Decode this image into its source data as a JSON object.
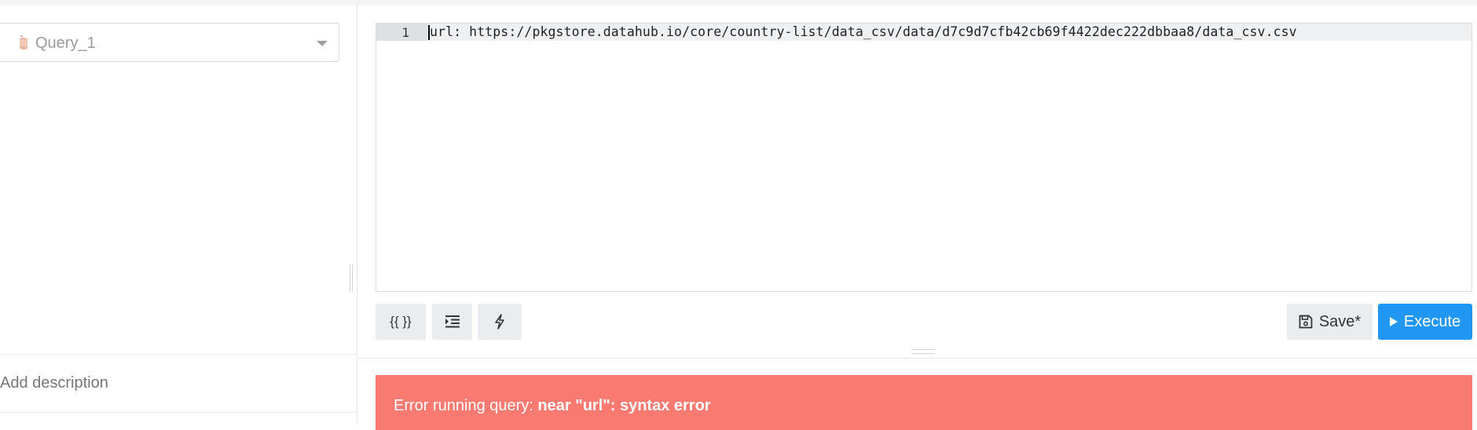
{
  "datasource": {
    "label": "Query_1",
    "icon": "sqlite-icon"
  },
  "sidebar": {
    "add_description": "Add description"
  },
  "editor": {
    "line_number": "1",
    "code": "url: https://pkgstore.datahub.io/core/country-list/data_csv/data/d7c9d7cfb42cb69f4422dec222dbbaa8/data_csv.csv"
  },
  "toolbar": {
    "format_label": "{{ }}",
    "indent_icon": "indent-icon",
    "autocomplete_icon": "bolt-icon",
    "save_label": "Save*",
    "save_icon": "floppy-icon",
    "execute_label": "Execute",
    "execute_icon": "play-icon"
  },
  "error": {
    "prefix": "Error running query: ",
    "detail": "near \"url\": syntax error"
  },
  "colors": {
    "execute_bg": "#2196f3",
    "error_bg": "#f87a70"
  }
}
